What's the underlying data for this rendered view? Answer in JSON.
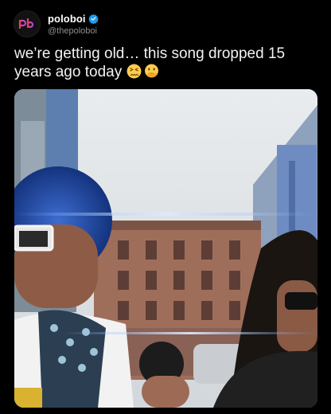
{
  "author": {
    "display_name": "poloboi",
    "handle": "@thepoloboi",
    "verified": true,
    "avatar_icon": "pb-logo-icon",
    "verified_icon": "verified-badge-icon"
  },
  "post": {
    "text": "we’re getting old… this song dropped 15 years ago today",
    "emojis": [
      "confounded-face-emoji",
      "face-with-hand-over-mouth-emoji"
    ]
  },
  "media": {
    "type": "video-still",
    "scene": "street-scene-photo"
  },
  "colors": {
    "background": "#000000",
    "text": "#f2f2f2",
    "handle": "#8b8f94",
    "verified": "#1d9bf0",
    "avatar_accent": "#e8416b"
  }
}
